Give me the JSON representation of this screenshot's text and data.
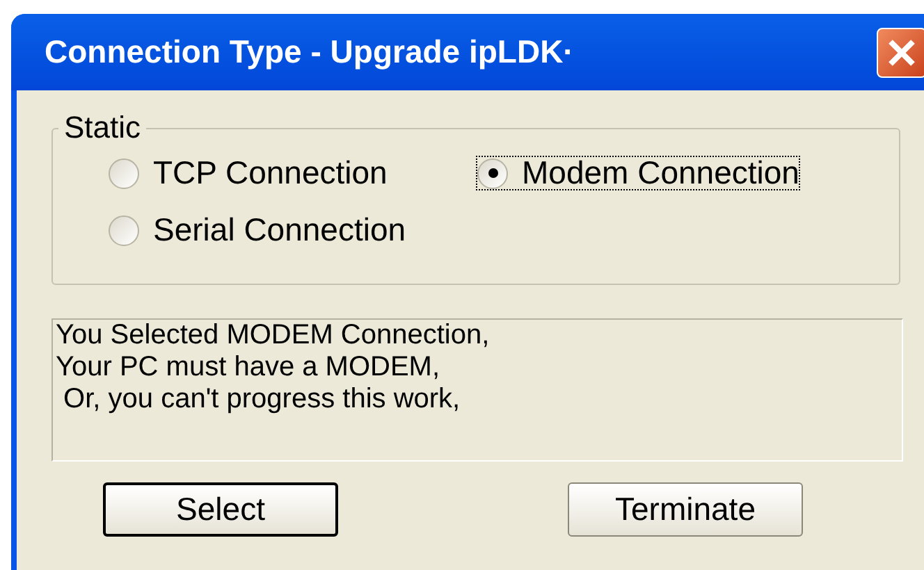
{
  "window": {
    "title": "Connection Type - Upgrade ipLDK·"
  },
  "group": {
    "label": "Static",
    "options": [
      {
        "label": "TCP Connection",
        "selected": false,
        "focused": false
      },
      {
        "label": "Modem Connection",
        "selected": true,
        "focused": true
      },
      {
        "label": "Serial Connection",
        "selected": false,
        "focused": false
      }
    ]
  },
  "message": {
    "lines": [
      "You Selected MODEM Connection,",
      "Your PC must have a MODEM,",
      " Or, you can't progress this work,"
    ]
  },
  "buttons": [
    {
      "label": "Select",
      "default": true
    },
    {
      "label": "Terminate",
      "default": false
    }
  ]
}
